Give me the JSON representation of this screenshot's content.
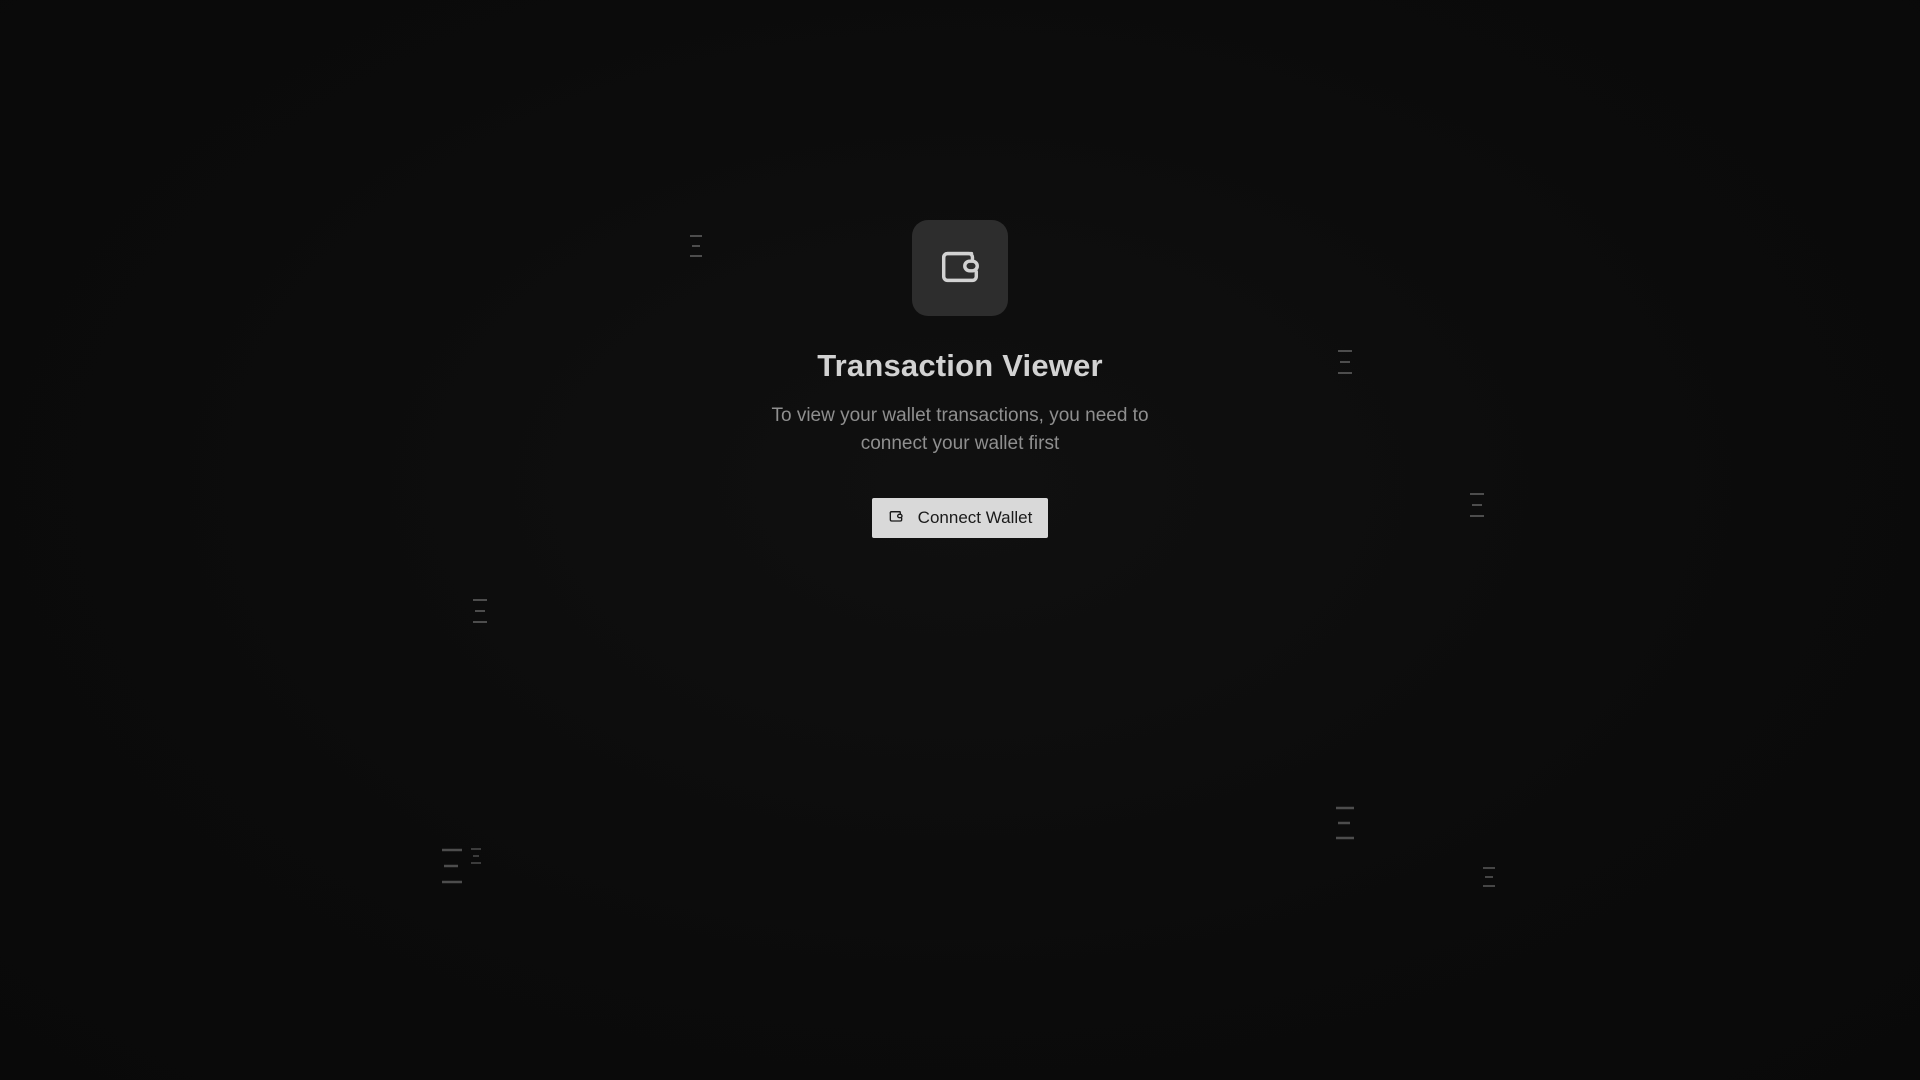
{
  "app": {
    "title": "Transaction Viewer",
    "subtitle": "To view your wallet transactions, you need to connect your wallet first",
    "connect_button_label": "Connect Wallet"
  },
  "icons": {
    "logo": "wallet-icon",
    "button": "wallet-icon",
    "decorations": "list-lines-icon"
  },
  "colors": {
    "background": "#0b0b0b",
    "logo_box": "#2d2d2d",
    "title": "#d2d2d2",
    "subtitle": "#8f8f8f",
    "button_bg": "#d9d9d9",
    "button_text": "#1a1a1a",
    "decoration": "#555555"
  }
}
